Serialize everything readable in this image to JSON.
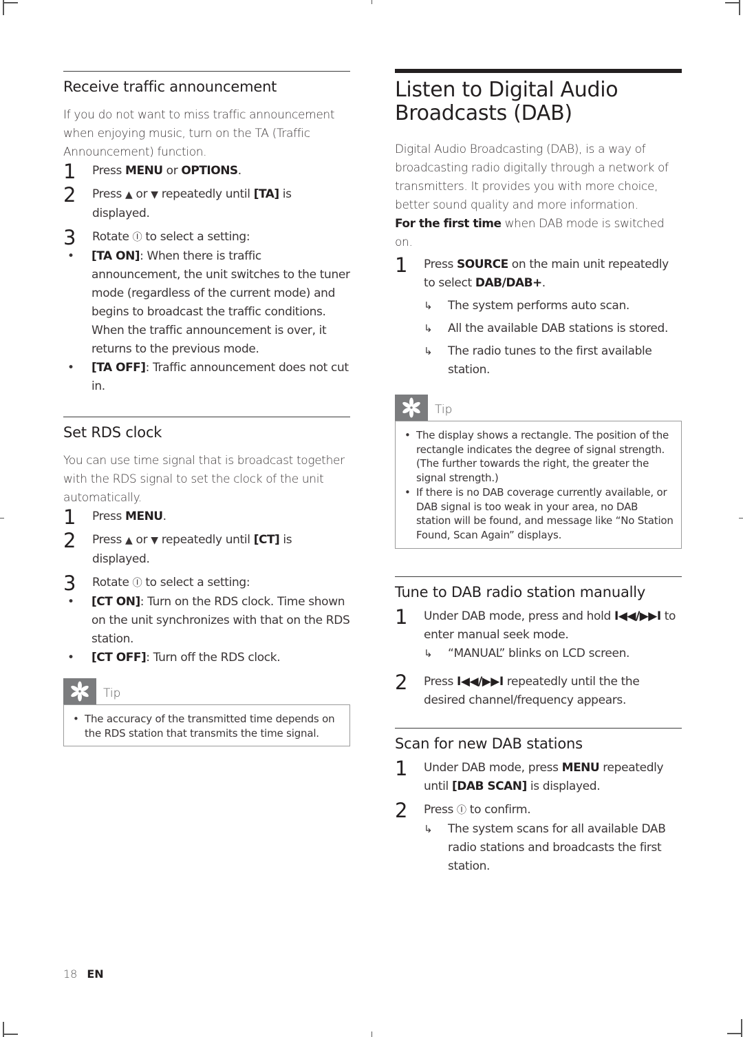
{
  "left_column": {
    "traffic": {
      "title": "Receive traffic announcement",
      "intro": "If you do not want to miss traffic announcement when enjoying music, turn on the TA (Traffic Announcement) function.",
      "steps": [
        {
          "num": "1",
          "pre": "Press ",
          "b1": "MENU",
          "mid": " or ",
          "b2": "OPTIONS",
          "post": "."
        },
        {
          "num": "2",
          "pre": "Press ",
          "up": "▲",
          "or": " or ",
          "down": "▼",
          "mid": " repeatedly until ",
          "b1": "[TA]",
          "post": " is displayed."
        },
        {
          "num": "3",
          "pre": "Rotate ",
          "knob": "Ⓘ",
          "post": " to select a setting:"
        }
      ],
      "options": [
        {
          "label": "[TA ON]",
          "text": ": When there is traffic announcement, the unit switches to the tuner mode (regardless of the current mode) and begins to broadcast the traffic conditions. When the traffic announcement is over, it returns to the previous mode."
        },
        {
          "label": "[TA OFF]",
          "text": ": Traffic announcement does not cut in."
        }
      ]
    },
    "rds": {
      "title": "Set RDS clock",
      "intro": "You can use time signal that is broadcast together with the RDS signal to set the clock of the unit automatically.",
      "steps": [
        {
          "num": "1",
          "pre": "Press ",
          "b1": "MENU",
          "post": "."
        },
        {
          "num": "2",
          "pre": "Press ",
          "up": "▲",
          "or": " or ",
          "down": "▼",
          "mid": " repeatedly until ",
          "b1": "[CT]",
          "post": " is displayed."
        },
        {
          "num": "3",
          "pre": "Rotate ",
          "knob": "Ⓘ",
          "post": " to select a setting:"
        }
      ],
      "options": [
        {
          "label": "[CT ON]",
          "text": ": Turn on the RDS clock. Time shown on the unit synchronizes with that on the RDS station."
        },
        {
          "label": "[CT OFF]",
          "text": ": Turn off the RDS clock."
        }
      ],
      "tip": {
        "label": "Tip",
        "items": [
          "The accuracy of the transmitted time depends on the RDS station that transmits the time signal."
        ]
      }
    }
  },
  "right_column": {
    "dab": {
      "title_line1": "Listen to Digital Audio",
      "title_line2": "Broadcasts (DAB)",
      "intro": "Digital Audio Broadcasting (DAB), is a way of broadcasting radio digitally through a network of transmitters. It provides you with more choice, better sound quality and more information.",
      "first_time_bold": "For the first time",
      "first_time_rest": " when DAB mode is switched on.",
      "step1": {
        "num": "1",
        "pre": "Press ",
        "b1": "SOURCE",
        "mid": " on the main unit repeatedly to select ",
        "b2": "DAB/DAB+",
        "post": "."
      },
      "results": [
        "The system performs auto scan.",
        "All the available DAB stations is stored.",
        "The radio tunes to the first available station."
      ],
      "tip": {
        "label": "Tip",
        "items": [
          "The display shows a rectangle. The position of the rectangle indicates the degree of signal strength. (The further towards the right, the greater the signal strength.)",
          "If there is no DAB coverage currently available, or DAB signal is too weak in your area, no DAB station will be found, and message like “No Station Found, Scan Again” displays."
        ]
      }
    },
    "manual": {
      "title": "Tune to DAB radio station manually",
      "step1": {
        "num": "1",
        "pre": "Under DAB mode, press and hold ",
        "b1": "I◀◀/▶▶I",
        "post": " to enter manual seek mode."
      },
      "step1_result": "“MANUAL” blinks on LCD screen.",
      "step2": {
        "num": "2",
        "pre": "Press ",
        "b1": "I◀◀/▶▶I",
        "post": " repeatedly until the the desired channel/frequency appears."
      }
    },
    "scan": {
      "title": "Scan for new DAB stations",
      "step1": {
        "num": "1",
        "pre": "Under DAB mode, press ",
        "b1": "MENU",
        "mid": " repeatedly until ",
        "b2": "[DAB SCAN]",
        "post": " is displayed."
      },
      "step2": {
        "num": "2",
        "pre": "Press ",
        "knob": "Ⓘ",
        "post": " to confirm."
      },
      "step2_result": "The system scans for all available DAB radio stations and broadcasts the first station."
    }
  },
  "footer": {
    "page_number": "18",
    "language": "EN"
  },
  "glyphs": {
    "bullet": "•",
    "arrow": "↳"
  }
}
